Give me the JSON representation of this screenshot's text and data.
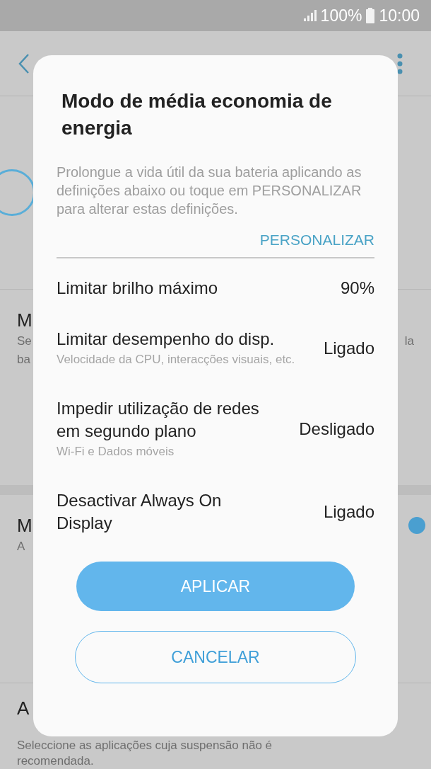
{
  "status_bar": {
    "battery": "100%",
    "time": "10:00"
  },
  "background": {
    "section_1": {
      "title": "M",
      "subtitle_lines": [
        "Se",
        "ba"
      ],
      "subtitle_right": "la"
    },
    "section_2": {
      "title": "M",
      "subtitle": "A"
    },
    "section_3": {
      "title": "A",
      "subtitle_lines": [
        "Seleccione as aplicações cuja suspensão não é",
        "recomendada."
      ]
    }
  },
  "dialog": {
    "title": "Modo de média economia de energia",
    "description": "Prolongue a vida útil da sua bateria aplicando as definições abaixo ou toque em PERSONALIZAR para alterar estas definições.",
    "customize_link": "PERSONALIZAR",
    "settings": [
      {
        "label": "Limitar brilho máximo",
        "value": "90%"
      },
      {
        "label": "Limitar desempenho do disp.",
        "value": "Ligado",
        "subtitle": "Velocidade da CPU, interacções visuais, etc."
      },
      {
        "label": "Impedir utilização de redes em segundo plano",
        "value": "Desligado",
        "subtitle": "Wi-Fi e Dados móveis"
      },
      {
        "label": "Desactivar Always On Display",
        "value": "Ligado"
      }
    ],
    "buttons": [
      {
        "label": "APLICAR",
        "kind": "primary"
      },
      {
        "label": "CANCELAR",
        "kind": "outline"
      }
    ]
  }
}
